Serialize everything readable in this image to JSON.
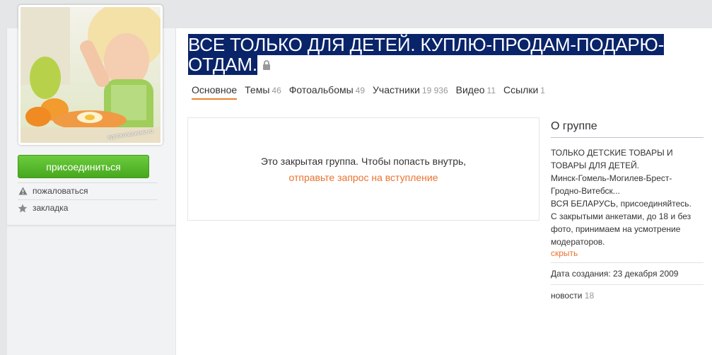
{
  "group": {
    "title_line1": "ВСЕ ТОЛЬКО ДЛЯ ДЕТЕЙ. КУПЛЮ-ПРОДАМ-ПОДАРЮ-",
    "title_line2": "ОТДАМ.",
    "lock_icon": "lock-icon",
    "avatar_watermark": "одноклассники.ru"
  },
  "sidebar": {
    "join_label": "присоединиться",
    "report_label": "пожаловаться",
    "report_icon": "warning-icon",
    "bookmark_label": "закладка",
    "bookmark_icon": "star-icon"
  },
  "tabs": [
    {
      "label": "Основное",
      "count": ""
    },
    {
      "label": "Темы",
      "count": "46"
    },
    {
      "label": "Фотоальбомы",
      "count": "49"
    },
    {
      "label": "Участники",
      "count": "19 936"
    },
    {
      "label": "Видео",
      "count": "11"
    },
    {
      "label": "Ссылки",
      "count": "1"
    }
  ],
  "closed": {
    "text": "Это закрытая группа. Чтобы попасть внутрь,",
    "link": "отправьте запрос на вступление"
  },
  "about": {
    "title": "О группе",
    "description": "ТОЛЬКО ДЕТСКИЕ ТОВАРЫ И\nТОВАРЫ ДЛЯ ДЕТЕЙ.\nМинск-Гомель-Могилев-Брест-\nГродно-Витебск...\nВСЯ БЕЛАРУСЬ, присоединяйтесь.\nС закрытыми анкетами, до 18 и без\nфото, принимаем на усмотрение\nмодераторов.",
    "hide_label": "скрыть",
    "created": "Дата создания: 23 декабря 2009",
    "news_label": "новости",
    "news_count": "18"
  },
  "colors": {
    "accent_orange": "#eb722e",
    "join_green": "#47a81f",
    "title_selection": "#0a246a"
  }
}
